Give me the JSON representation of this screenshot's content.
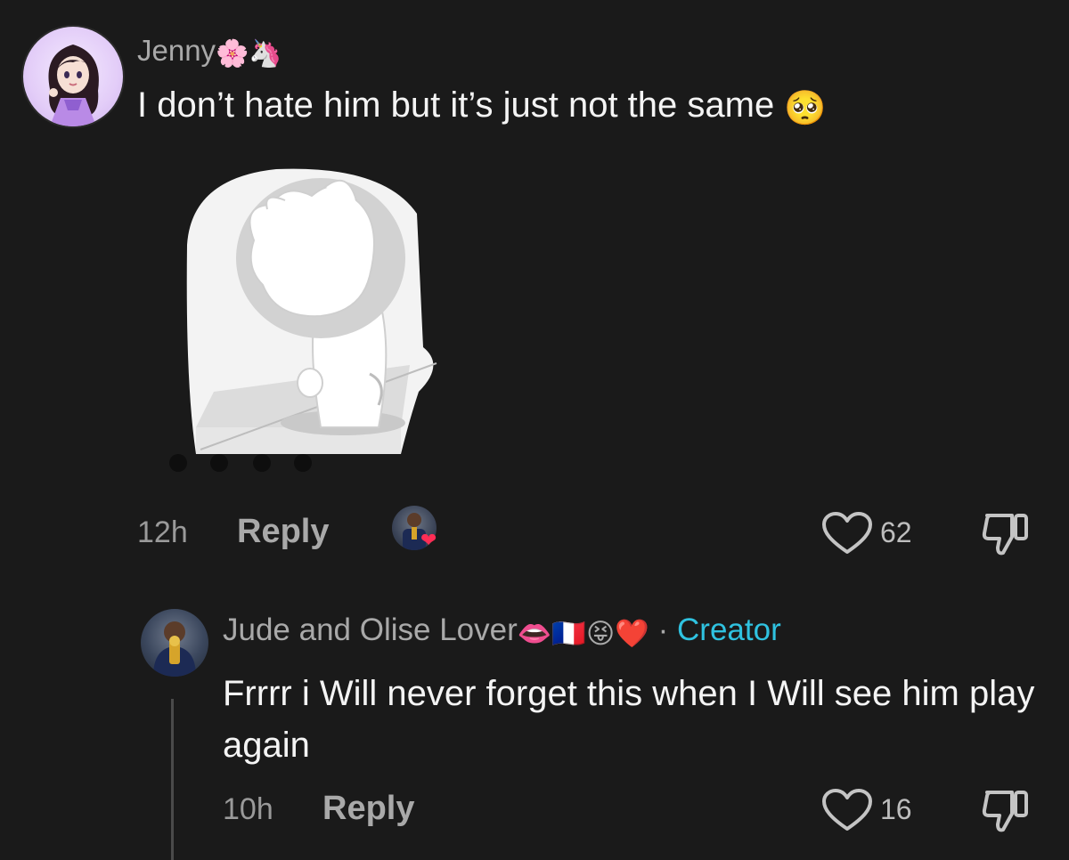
{
  "comments": [
    {
      "username": "Jenny",
      "username_emojis": "🌸🦄",
      "text": "I don’t hate him but it’s just not the same",
      "text_emoji": "🥺",
      "time": "12h",
      "reply_label": "Reply",
      "likes": "62",
      "liked_by_creator": true
    },
    {
      "username": "Jude and Olise Lover",
      "username_emojis": "👄🇫🇷😝❤️",
      "separator": "·",
      "badge": "Creator",
      "text": "Frrrr i Will never forget this when I Will see him play again",
      "time": "10h",
      "reply_label": "Reply",
      "likes": "16"
    }
  ],
  "colors": {
    "background": "#1a1a1a",
    "creator_badge": "#2fc2e0",
    "muted_text": "#a9a9a9"
  },
  "icons": {
    "like": "heart-outline-icon",
    "dislike": "thumbs-down-icon",
    "creator_heart": "heart-icon"
  }
}
